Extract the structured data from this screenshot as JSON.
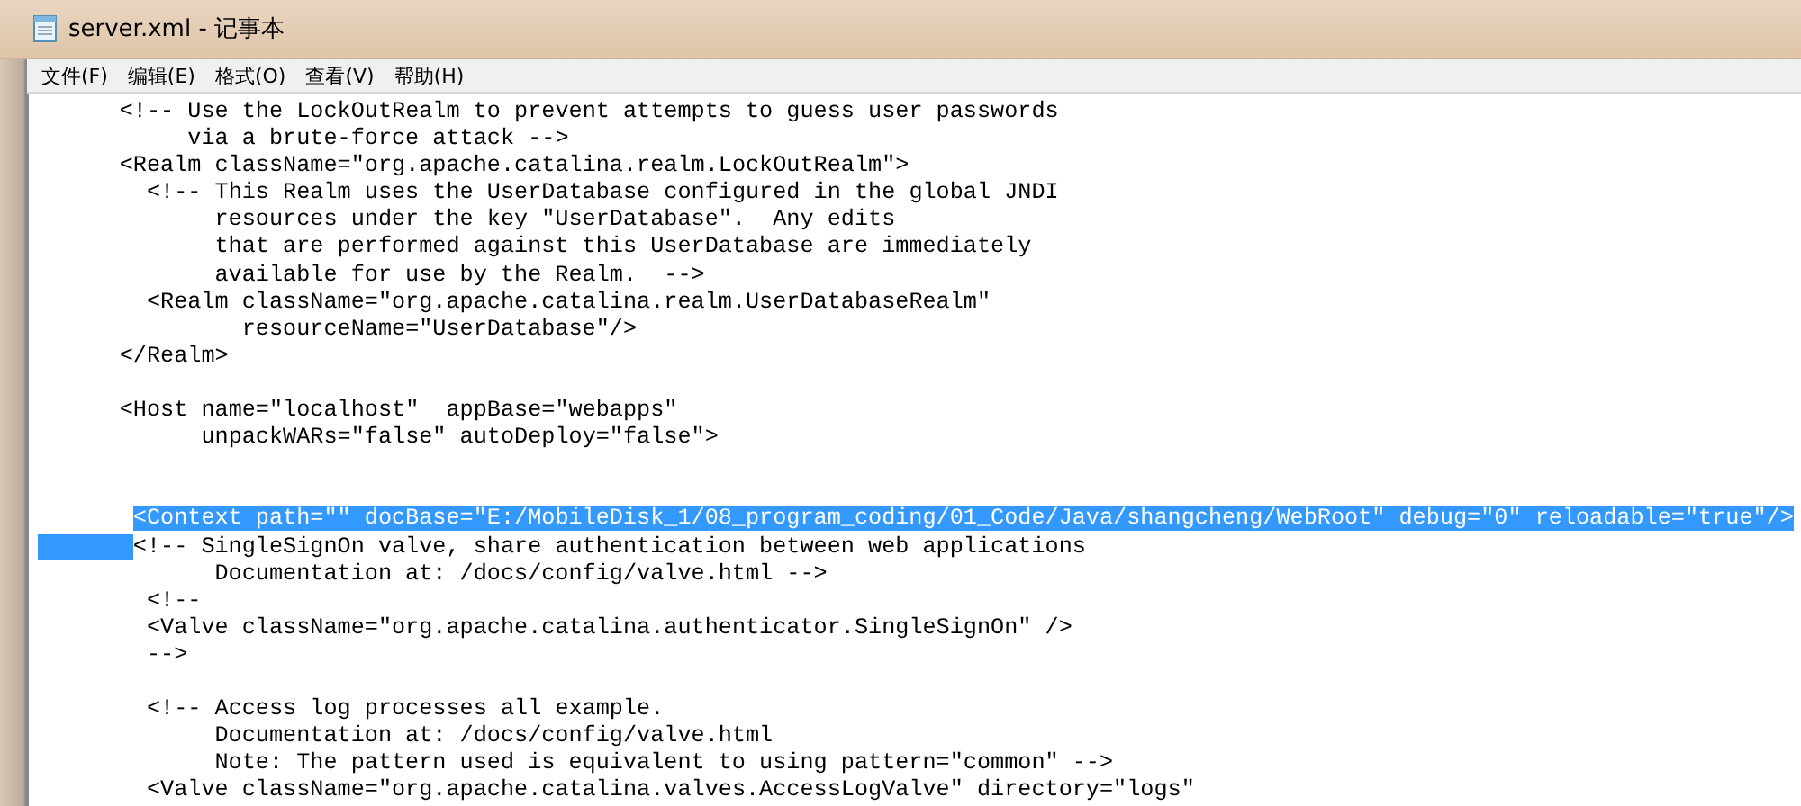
{
  "window": {
    "title": "server.xml - 记事本"
  },
  "menu": [
    {
      "label": "文件(F)"
    },
    {
      "label": "编辑(E)"
    },
    {
      "label": "格式(O)"
    },
    {
      "label": "查看(V)"
    },
    {
      "label": "帮助(H)"
    }
  ],
  "editor": {
    "lines": [
      {
        "text": "      <!-- Use the LockOutRealm to prevent attempts to guess user passwords",
        "selected": false
      },
      {
        "text": "           via a brute-force attack -->",
        "selected": false
      },
      {
        "text": "      <Realm className=\"org.apache.catalina.realm.LockOutRealm\">",
        "selected": false
      },
      {
        "text": "        <!-- This Realm uses the UserDatabase configured in the global JNDI",
        "selected": false
      },
      {
        "text": "             resources under the key \"UserDatabase\".  Any edits",
        "selected": false
      },
      {
        "text": "             that are performed against this UserDatabase are immediately",
        "selected": false
      },
      {
        "text": "             available for use by the Realm.  -->",
        "selected": false
      },
      {
        "text": "        <Realm className=\"org.apache.catalina.realm.UserDatabaseRealm\"",
        "selected": false
      },
      {
        "text": "               resourceName=\"UserDatabase\"/>",
        "selected": false
      },
      {
        "text": "      </Realm>",
        "selected": false
      },
      {
        "kind": "blank"
      },
      {
        "text": "      <Host name=\"localhost\"  appBase=\"webapps\"",
        "selected": false
      },
      {
        "text": "            unpackWARs=\"false\" autoDeploy=\"false\">",
        "selected": false
      },
      {
        "kind": "blank"
      },
      {
        "kind": "blank"
      },
      {
        "text": "       <Context path=\"\" docBase=\"E:/MobileDisk_1/08_program_coding/01_Code/Java/shangcheng/WebRoot\" debug=\"0\" reloadable=\"true\"/>",
        "selected": true
      },
      {
        "text": "       <!-- SingleSignOn valve, share authentication between web applications",
        "selected": false
      },
      {
        "text": "             Documentation at: /docs/config/valve.html -->",
        "selected": false
      },
      {
        "text": "        <!--",
        "selected": false
      },
      {
        "text": "        <Valve className=\"org.apache.catalina.authenticator.SingleSignOn\" />",
        "selected": false
      },
      {
        "text": "        -->",
        "selected": false
      },
      {
        "kind": "blank"
      },
      {
        "text": "        <!-- Access log processes all example.",
        "selected": false
      },
      {
        "text": "             Documentation at: /docs/config/valve.html",
        "selected": false
      },
      {
        "text": "             Note: The pattern used is equivalent to using pattern=\"common\" -->",
        "selected": false
      },
      {
        "text": "        <Valve className=\"org.apache.catalina.valves.AccessLogValve\" directory=\"logs\"",
        "selected": false
      }
    ]
  }
}
